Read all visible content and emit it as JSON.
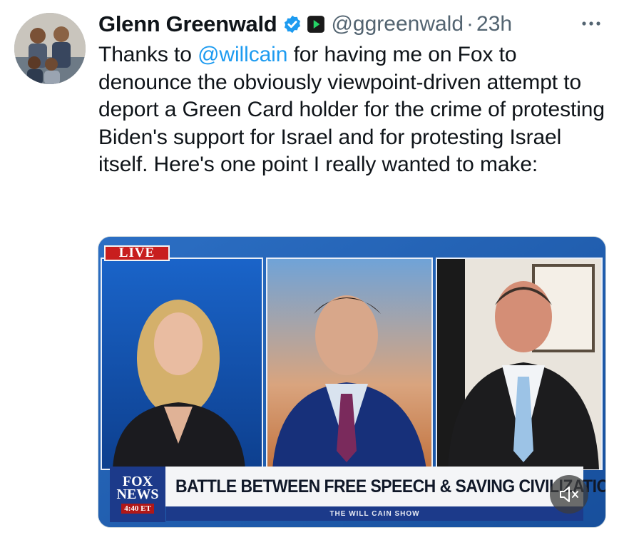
{
  "author": {
    "name": "Glenn Greenwald",
    "handle": "@ggreenwald",
    "time": "23h",
    "separator": "·",
    "verified_color": "#1d9bf0",
    "affiliate_badge_color": "#1a1a1a"
  },
  "tweet": {
    "text_before_mention": "Thanks to ",
    "mention": "@willcain",
    "text_after_mention": " for having me on Fox to denounce the obviously viewpoint-driven attempt to deport a Green Card holder for the crime of protesting Biden's support for Israel and for protesting Israel itself. Here's one point I really wanted to make:"
  },
  "media": {
    "live_label": "LIVE",
    "chyron": "BATTLE BETWEEN FREE SPEECH & SAVING CIVILIZATION",
    "network_logo_line1": "FOX",
    "network_logo_line2": "NEWS",
    "clock": "4:40 ET",
    "show_name": "THE WILL CAIN SHOW",
    "mute_icon": "speaker-muted-icon"
  },
  "colors": {
    "link": "#1d9bf0",
    "secondary_text": "#536471",
    "fox_blue": "#1c3a8a",
    "live_red": "#c81e1e"
  }
}
